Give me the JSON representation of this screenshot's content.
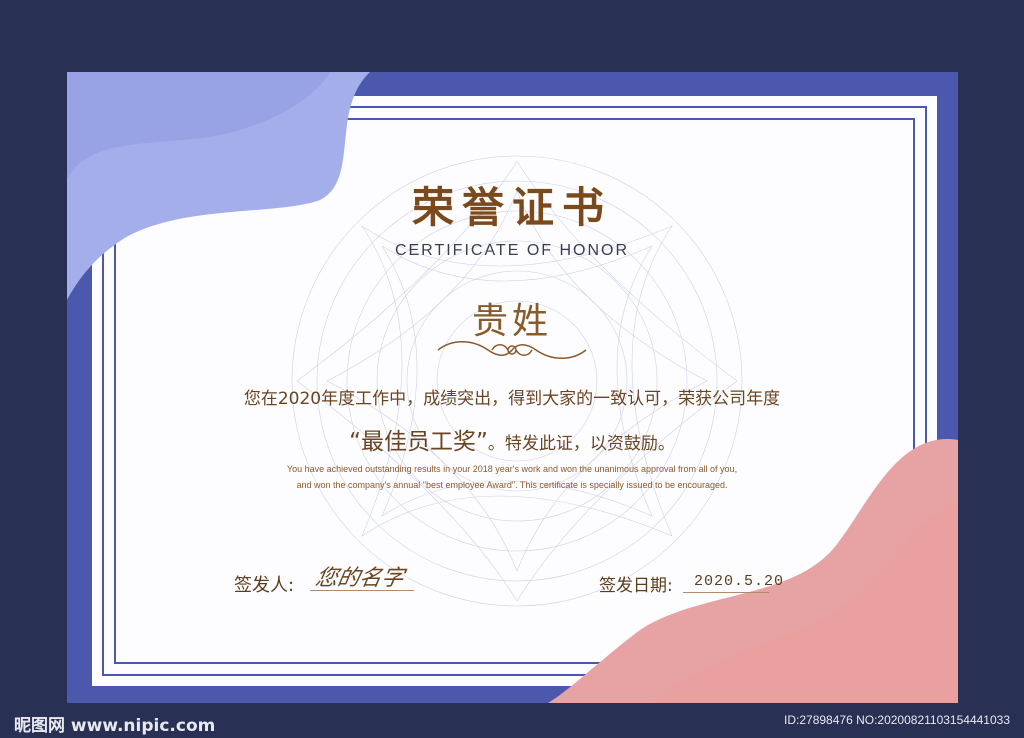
{
  "certificate": {
    "title": "荣誉证书",
    "subtitle": "CERTIFICATE OF HONOR",
    "recipient": "贵姓",
    "body_line": "您在2020年度工作中，成绩突出，得到大家的一致认可，荣获公司年度",
    "award_name": "“最佳员工奖”",
    "award_suffix": "。特发此证，以资鼓励。",
    "english_line1": "You have achieved outstanding results in your 2018 year's work and won the unanimous approval from all of you,",
    "english_line2": "and won the company's annual \"best employee Award\". This certificate is specially issued to be encouraged.",
    "signer_label": "签发人:",
    "signer_signature": "您的名字",
    "date_label": "签发日期:",
    "date_value": "2020.5.20"
  },
  "watermark": {
    "site": "昵图网 www.nipic.com",
    "id_text": "ID:27898476 NO:20200821103154441033"
  },
  "colors": {
    "background": "#283154",
    "frame": "#4c58ad",
    "gold": "#7a4a1c",
    "lavender": "#a3aeea",
    "pink": "#e7a3a3"
  }
}
